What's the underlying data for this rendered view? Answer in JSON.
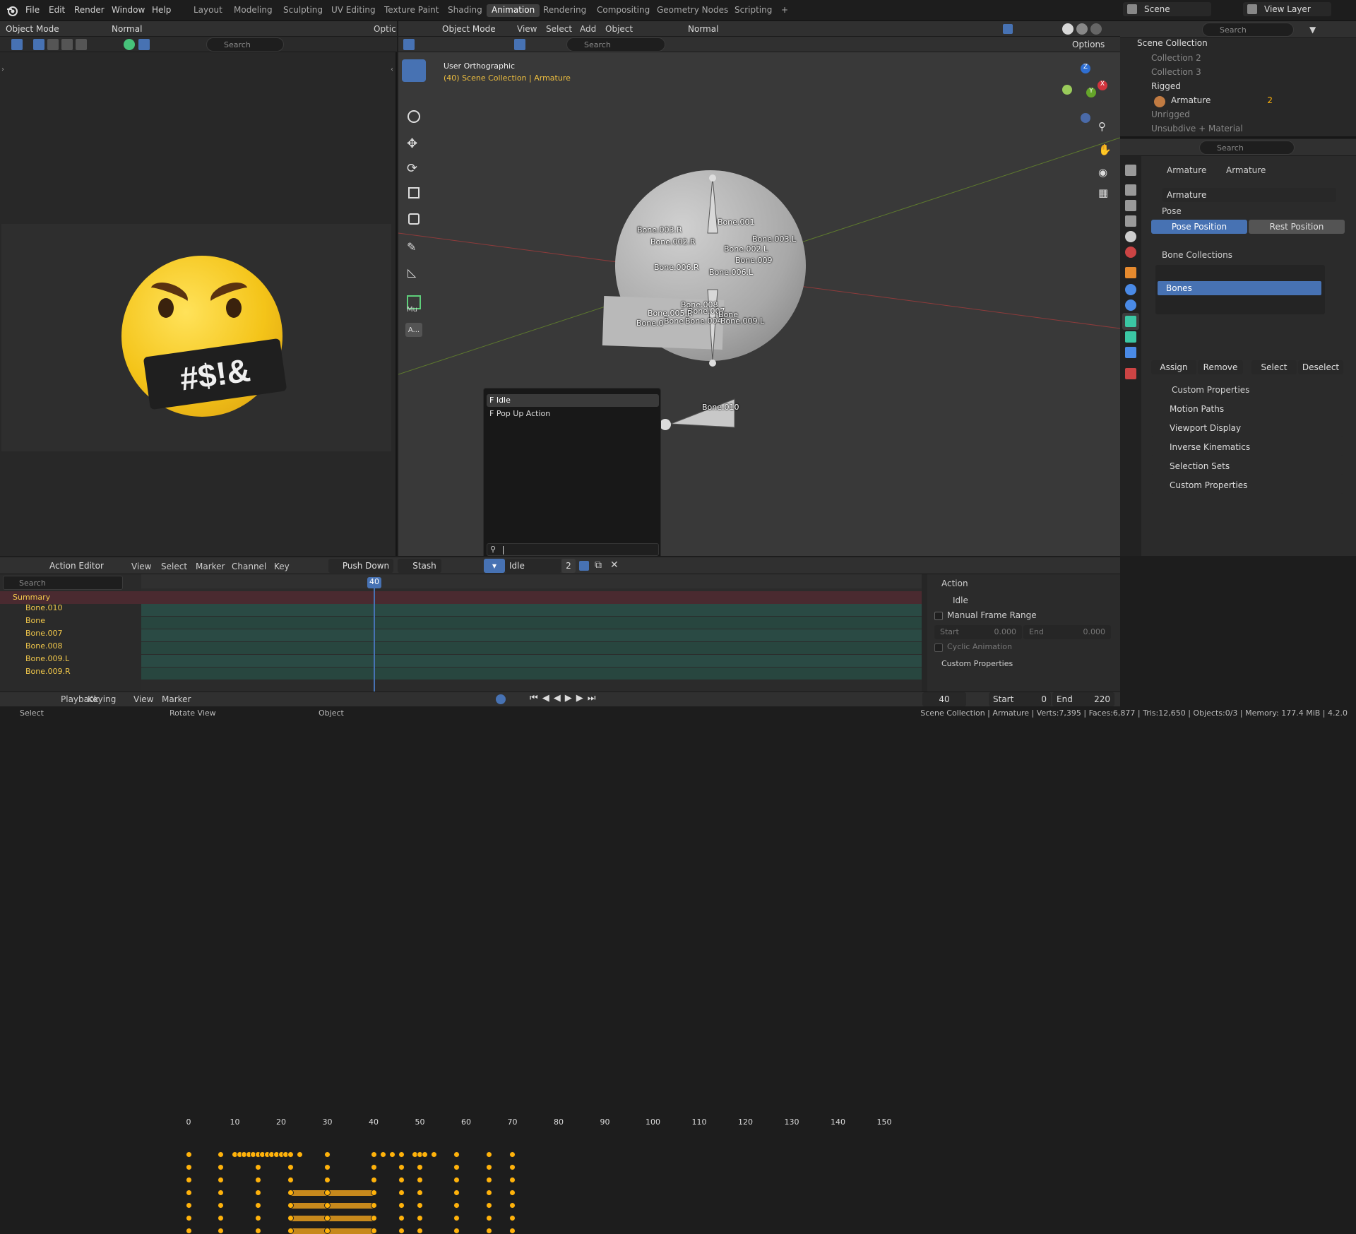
{
  "topbar": {
    "menus": [
      "File",
      "Edit",
      "Render",
      "Window",
      "Help"
    ],
    "workspaces": [
      "Layout",
      "Modeling",
      "Sculpting",
      "UV Editing",
      "Texture Paint",
      "Shading",
      "Animation",
      "Rendering",
      "Compositing",
      "Geometry Nodes",
      "Scripting"
    ],
    "active_workspace": "Animation",
    "add_tab": "+",
    "scene": "Scene",
    "view_layer": "View Layer"
  },
  "left_viewport": {
    "mode": "Object Mode",
    "shading_mode": "Normal",
    "search_placeholder": "Search",
    "options_truncated": "Optic",
    "emoji_text": "#$!&"
  },
  "main_viewport": {
    "mode": "Object Mode",
    "menus": [
      "View",
      "Select",
      "Add",
      "Object"
    ],
    "orientation": "Normal",
    "search_placeholder": "Search",
    "options": "Options",
    "view_name": "User Orthographic",
    "view_context": "(40) Scene Collection | Armature",
    "side_panel_label": "Mu",
    "side_panel_btn": "A...",
    "bones": [
      "Bone.001",
      "Bone.003.R",
      "Bone.002.R",
      "Bone.003.L",
      "Bone.002.L",
      "Bone.009",
      "Bone.006.R",
      "Bone.006.L",
      "Bone.008",
      "Bone.007",
      "Bone.010"
    ],
    "cluster_labels": [
      "Bone.005.R",
      "Bone.0",
      "Bone",
      "Bone.004",
      "Bone.009.L",
      "Bone"
    ]
  },
  "action_popup": {
    "items": [
      "F Idle",
      "F Pop Up Action"
    ],
    "search_value": ""
  },
  "outliner": {
    "search_placeholder": "Search",
    "root": "Scene Collection",
    "items": [
      {
        "label": "Collection 2",
        "dim": true
      },
      {
        "label": "Collection 3",
        "dim": true
      },
      {
        "label": "Rigged",
        "dim": false
      },
      {
        "label": "Armature",
        "dim": false
      },
      {
        "label": "Unrigged",
        "dim": true
      },
      {
        "label": "Unsubdive + Material",
        "dim": true
      }
    ],
    "armature_badge": "2"
  },
  "properties": {
    "search_placeholder": "Search",
    "breadcrumb": [
      "Armature",
      "Armature"
    ],
    "data_name": "Armature",
    "pose_section": "Pose",
    "pose_position": "Pose Position",
    "rest_position": "Rest Position",
    "bone_collections_section": "Bone Collections",
    "bone_collection": "Bones",
    "assign": "Assign",
    "remove": "Remove",
    "select": "Select",
    "deselect": "Deselect",
    "custom_props_sub": "Custom Properties",
    "panels": [
      "Motion Paths",
      "Viewport Display",
      "Inverse Kinematics",
      "Selection Sets",
      "Custom Properties"
    ]
  },
  "action_editor": {
    "editor_name": "Action Editor",
    "menus": [
      "View",
      "Select",
      "Marker",
      "Channel",
      "Key"
    ],
    "push_down": "Push Down",
    "stash": "Stash",
    "action_name": "Idle",
    "users": "2",
    "search_placeholder": "Search",
    "ruler": [
      "0",
      "10",
      "20",
      "30",
      "40",
      "50",
      "60",
      "70",
      "80",
      "90",
      "100",
      "110",
      "120",
      "130",
      "140",
      "150"
    ],
    "current_frame": "40",
    "summary": "Summary",
    "channels": [
      "Bone.010",
      "Bone",
      "Bone.007",
      "Bone.008",
      "Bone.009.L",
      "Bone.009.R"
    ],
    "keyframes": [
      0,
      7,
      15,
      22,
      30,
      40,
      46,
      50,
      58,
      65,
      70
    ],
    "summary_keyframes": [
      0,
      7,
      10,
      11,
      12,
      13,
      14,
      15,
      16,
      17,
      18,
      19,
      20,
      21,
      22,
      24,
      30,
      40,
      42,
      44,
      46,
      49,
      50,
      51,
      53,
      58,
      65,
      70
    ],
    "hold_channels": [
      2,
      3,
      4,
      5
    ],
    "hold_range": [
      22,
      40
    ],
    "sidebar": {
      "action_section": "Action",
      "action_name": "Idle",
      "manual_frame_range": "Manual Frame Range",
      "start_label": "Start",
      "start_value": "0.000",
      "end_label": "End",
      "end_value": "0.000",
      "cyclic": "Cyclic Animation",
      "custom_props": "Custom Properties"
    }
  },
  "timeline": {
    "menus": [
      "Playback",
      "Keying",
      "View",
      "Marker"
    ],
    "current": "40",
    "start_label": "Start",
    "start": "0",
    "end_label": "End",
    "end": "220"
  },
  "status_bar": {
    "select": "Select",
    "rotate": "Rotate View",
    "object": "Object",
    "stats": "Scene Collection | Armature | Verts:7,395 | Faces:6,877 | Tris:12,650 | Objects:0/3 | Memory: 177.4 MiB | 4.2.0"
  },
  "colors": {
    "accent": "#4772b3",
    "keyframe": "#ffb20a",
    "playhead": "#4772b3",
    "channel_bg": "#2a4a44",
    "summary_bg": "#4a2a30"
  }
}
